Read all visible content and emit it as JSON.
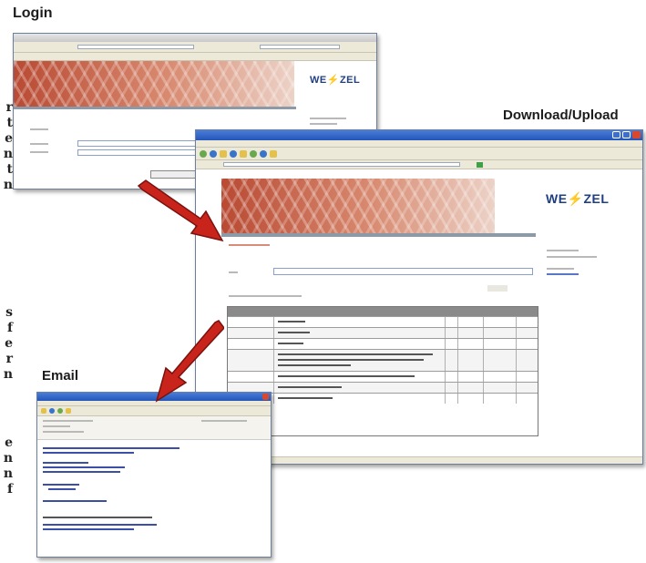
{
  "captions": {
    "login": "Login",
    "download_upload": "Download/Upload",
    "email": "Email"
  },
  "edge_letters": [
    "r",
    "t",
    "e",
    "n",
    "t",
    "n",
    "s",
    "f",
    "e",
    "r",
    "n",
    "e",
    "n",
    "n",
    "f"
  ],
  "brand": {
    "logo_left": "WE",
    "logo_bolt": "⚡",
    "logo_right": "ZEL"
  },
  "colors": {
    "titlebar_blue": "#2356b8",
    "banner_red": "#b94a33",
    "arrow_red": "#c8241c",
    "logo_blue": "#1f3f82"
  },
  "icons": {
    "arrow_1": "red-arrow-icon",
    "arrow_2": "red-arrow-icon"
  }
}
